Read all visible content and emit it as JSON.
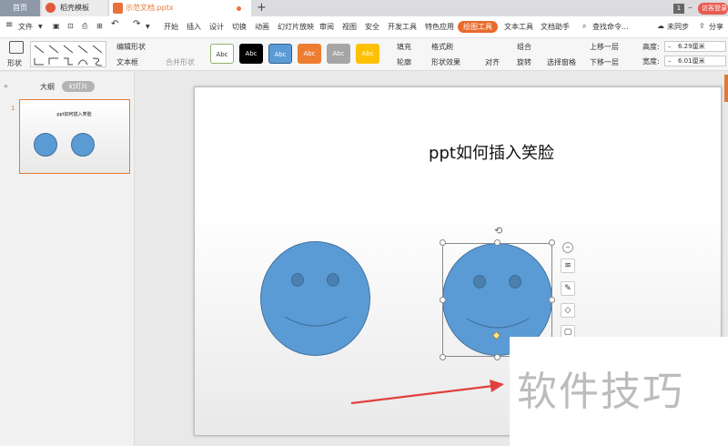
{
  "tabs": {
    "home": "首页",
    "template": "稻壳模板",
    "document": "示范文档.pptx"
  },
  "window": {
    "page_count": "1",
    "visitor_login": "访客登录",
    "min_icon": "minimize-icon"
  },
  "menu": {
    "file": "文件",
    "items": [
      "开始",
      "插入",
      "设计",
      "切换",
      "动画",
      "幻灯片放映",
      "审阅",
      "视图",
      "安全",
      "开发工具",
      "特色应用"
    ],
    "active": "绘图工具",
    "after": [
      "文本工具",
      "文档助手"
    ],
    "search": "查找命令...",
    "sync": "未同步",
    "share": "分享"
  },
  "ribbon": {
    "shape": "形状",
    "edit_shape": "编辑形状",
    "text_box": "文本框",
    "merge_shape": "合并形状",
    "styles": [
      "Abc",
      "Abc",
      "Abc",
      "Abc",
      "Abc",
      "Abc"
    ],
    "style_colors": [
      "#ffffff",
      "#000000",
      "#5b9bd5",
      "#ed7d31",
      "#a5a5a5",
      "#ffc000"
    ],
    "fill": "填充",
    "format_brush": "格式刷",
    "outline": "轮廓",
    "shape_effect": "形状效果",
    "align": "对齐",
    "group": "组合",
    "rotate": "旋转",
    "selection_pane": "选择窗格",
    "bring_forward": "上移一层",
    "send_backward": "下移一层",
    "height_label": "高度:",
    "height_value": "6.29厘米",
    "width_label": "宽度:",
    "width_value": "6.01厘米"
  },
  "panel": {
    "outline_tab": "大纲",
    "slides_tab": "幻灯片",
    "slide_number": "1",
    "thumb_title": "ppt如何插入笑脸"
  },
  "slide": {
    "title": "ppt如何插入笑脸"
  },
  "watermark": "软件技巧",
  "colors": {
    "accent": "#e86b2c",
    "shape_fill": "#5b9bd5",
    "arrow": "#e0413d"
  }
}
